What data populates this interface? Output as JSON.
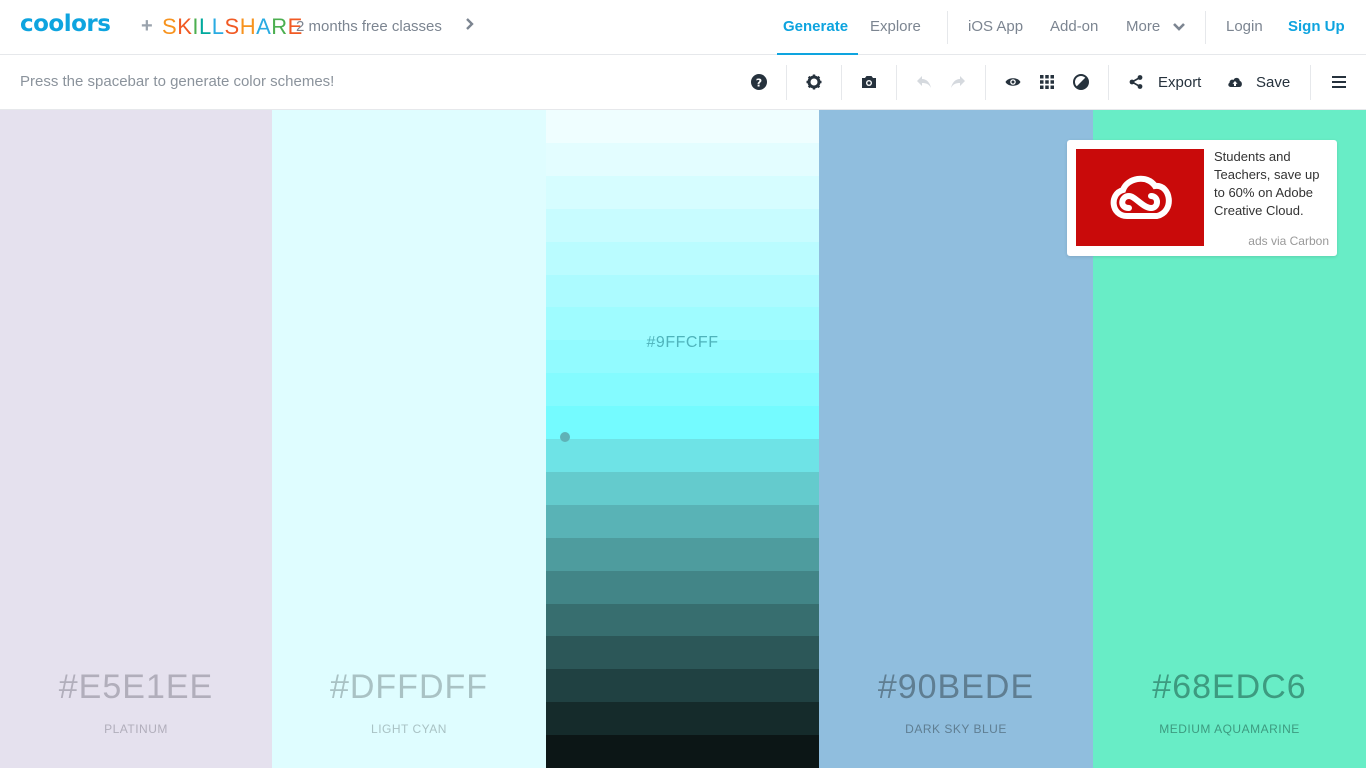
{
  "nav": {
    "logo": "coolors",
    "plus": "+",
    "partner_letters": [
      {
        "ch": "S",
        "color": "#f7931e"
      },
      {
        "ch": "K",
        "color": "#f15a24"
      },
      {
        "ch": "I",
        "color": "#4caf50"
      },
      {
        "ch": "L",
        "color": "#00a99d"
      },
      {
        "ch": "L",
        "color": "#29abe2"
      },
      {
        "ch": "S",
        "color": "#f15a24"
      },
      {
        "ch": "H",
        "color": "#f7931e"
      },
      {
        "ch": "A",
        "color": "#29abe2"
      },
      {
        "ch": "R",
        "color": "#4caf50"
      },
      {
        "ch": "E",
        "color": "#f15a24"
      }
    ],
    "promo": "2 months free classes",
    "links": {
      "generate": "Generate",
      "explore": "Explore",
      "ios_app": "iOS App",
      "addon": "Add-on",
      "more": "More",
      "login": "Login",
      "signup": "Sign Up"
    },
    "accent_color": "#0ea4df"
  },
  "toolbar": {
    "hint": "Press the spacebar to generate color schemes!",
    "export_label": "Export",
    "save_label": "Save",
    "icons": [
      "help-icon",
      "settings-icon",
      "camera-icon",
      "undo-icon",
      "redo-icon",
      "view-icon",
      "grid-icon",
      "contrast-icon",
      "share-icon",
      "upload-icon",
      "menu-icon"
    ]
  },
  "palette": {
    "colors": [
      {
        "hex": "#E5E1EE",
        "name": "PLATINUM",
        "bg": "#e5e1ee",
        "text": "#b1aebb"
      },
      {
        "hex": "#DFFDFF",
        "name": "LIGHT CYAN",
        "bg": "#dffdff",
        "text": "#a9c2c4"
      },
      {
        "hex": "#9FFCFF",
        "name": "",
        "bg": "#9ffcff",
        "text": "#4fb3bb"
      },
      {
        "hex": "#90BEDE",
        "name": "DARK SKY BLUE",
        "bg": "#90bede",
        "text": "#5f7e92"
      },
      {
        "hex": "#68EDC6",
        "name": "MEDIUM AQUAMARINE",
        "bg": "#68edc6",
        "text": "#3d9b80"
      }
    ],
    "shades": [
      "#effeff",
      "#e3fdff",
      "#d6fdff",
      "#c8fcff",
      "#bafcff",
      "#acfbff",
      "#9ffcff",
      "#92fbff",
      "#84fbff",
      "#74fbff",
      "#6ee3e6",
      "#64cbcd",
      "#59b3b6",
      "#4e9c9e",
      "#428587",
      "#376e6f",
      "#2c5758",
      "#204142",
      "#152b2b",
      "#0c1616"
    ]
  },
  "ad": {
    "text": "Students and Teachers, save up to 60% on Adobe Creative Cloud.",
    "via": "ads via Carbon",
    "brand_color": "#c90a0a"
  }
}
